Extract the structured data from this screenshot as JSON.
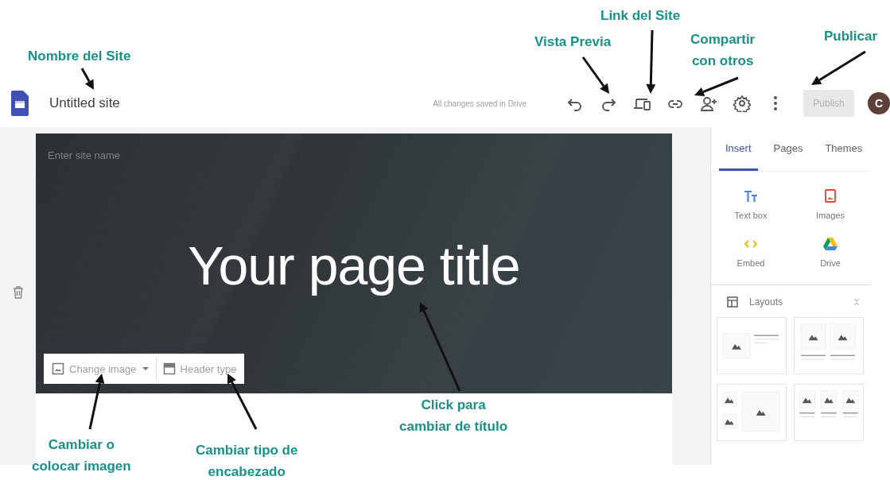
{
  "app": {
    "title": "Untitled site",
    "save_status": "All changes saved in Drive",
    "publish": {
      "label": "Publish",
      "disabled": true
    },
    "avatar": "C"
  },
  "header": {
    "site_name_placeholder": "Enter site name",
    "page_title": "Your page title",
    "image_toolbar": [
      {
        "kind": "image",
        "label": "Change image"
      },
      {
        "kind": "header",
        "label": "Header type"
      }
    ]
  },
  "panel": {
    "tabs": [
      {
        "label": "Insert",
        "selected": true
      },
      {
        "label": "Pages",
        "selected": false
      },
      {
        "label": "Themes",
        "selected": false
      }
    ],
    "insert_items": [
      {
        "kind": "text",
        "label": "Text box"
      },
      {
        "kind": "image",
        "label": "Images"
      },
      {
        "kind": "embed",
        "label": "Embed"
      },
      {
        "kind": "drive",
        "label": "Drive"
      }
    ],
    "layouts": {
      "title": "Layouts"
    }
  },
  "annotations": [
    {
      "lines": [
        "Nombre del Site"
      ]
    },
    {
      "lines": [
        "Vista Previa"
      ]
    },
    {
      "lines": [
        "Link del Site"
      ]
    },
    {
      "lines": [
        "Compartir",
        "con otros"
      ]
    },
    {
      "lines": [
        "Publicar"
      ]
    },
    {
      "lines": [
        "Cambiar o",
        "colocar imagen"
      ]
    },
    {
      "lines": [
        "Cambiar tipo de",
        "encabezado"
      ]
    },
    {
      "lines": [
        "Click para",
        "cambiar de título"
      ]
    }
  ]
}
